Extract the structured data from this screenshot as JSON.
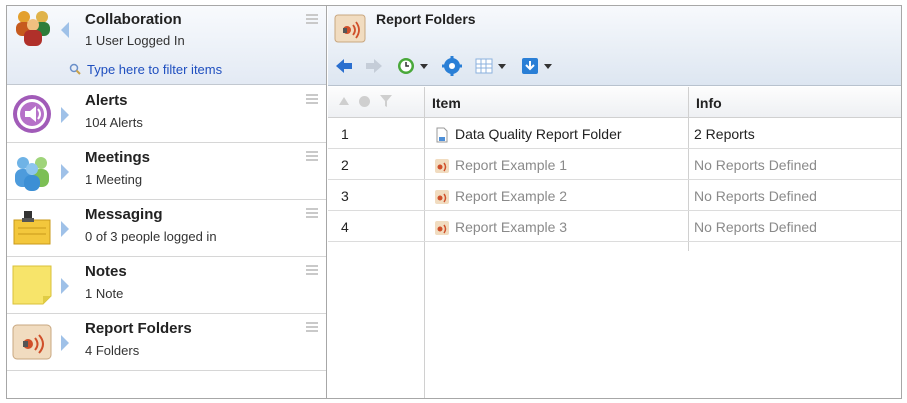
{
  "collaboration": {
    "title": "Collaboration",
    "subtitle": "1 User Logged In",
    "filter_placeholder": "Type here to filter items"
  },
  "sidebar": {
    "items": [
      {
        "title": "Alerts",
        "subtitle": "104 Alerts",
        "icon": "alert-speaker-icon"
      },
      {
        "title": "Meetings",
        "subtitle": "1 Meeting",
        "icon": "meeting-people-icon"
      },
      {
        "title": "Messaging",
        "subtitle": "0 of 3 people logged in",
        "icon": "messaging-clipboard-icon"
      },
      {
        "title": "Notes",
        "subtitle": "1 Note",
        "icon": "sticky-note-icon"
      },
      {
        "title": "Report Folders",
        "subtitle": "4 Folders",
        "icon": "report-speaker-icon"
      }
    ]
  },
  "main": {
    "title": "Report Folders",
    "columns": {
      "item": "Item",
      "info": "Info"
    },
    "rows": [
      {
        "num": "1",
        "name": "Data Quality Report Folder",
        "info": "2 Reports"
      },
      {
        "num": "2",
        "name": "Report Example 1",
        "info": "No Reports Defined"
      },
      {
        "num": "3",
        "name": "Report Example 2",
        "info": "No Reports Defined"
      },
      {
        "num": "4",
        "name": "Report Example 3",
        "info": "No Reports Defined"
      }
    ]
  },
  "colors": {
    "accent": "#1f4fbf",
    "arrow": "#9fc1e8",
    "toolbar_blue": "#2a6fcf"
  }
}
